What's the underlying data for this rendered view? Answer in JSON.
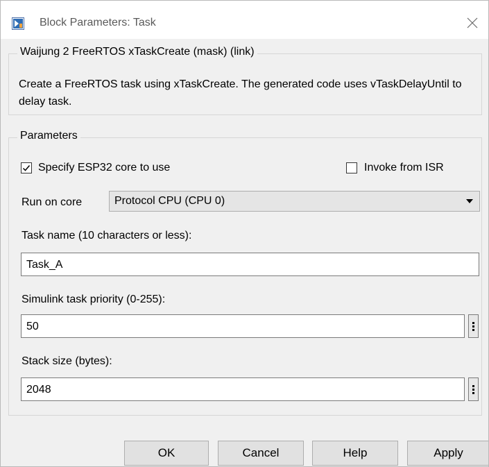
{
  "window": {
    "title": "Block Parameters: Task",
    "icon": "simulink-block-icon",
    "close_icon": "close-icon"
  },
  "mask_group": {
    "title": "Waijung 2 FreeRTOS xTaskCreate (mask) (link)",
    "description": "Create a FreeRTOS task using xTaskCreate. The generated code uses vTaskDelayUntil to delay task."
  },
  "parameters_group": {
    "title": "Parameters",
    "specify_core": {
      "label": "Specify ESP32 core to use",
      "checked": true
    },
    "invoke_from_isr": {
      "label": "Invoke from ISR",
      "checked": false
    },
    "run_on_core": {
      "label": "Run on core",
      "value": "Protocol CPU (CPU 0)"
    },
    "task_name": {
      "label": "Task name (10 characters or less):",
      "value": "Task_A"
    },
    "priority": {
      "label": "Simulink task priority (0-255):",
      "value": "50"
    },
    "stack_size": {
      "label": "Stack size (bytes):",
      "value": "2048"
    }
  },
  "buttons": {
    "ok": "OK",
    "cancel": "Cancel",
    "help": "Help",
    "apply": "Apply"
  }
}
